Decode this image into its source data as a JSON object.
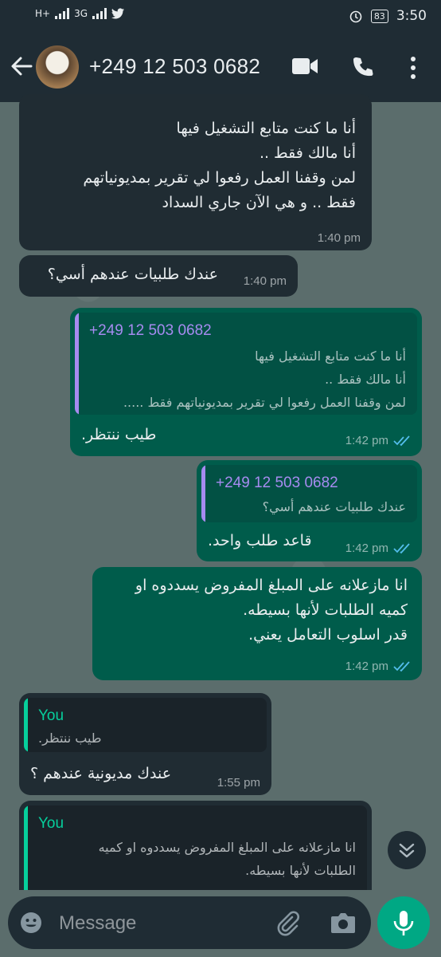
{
  "status_bar": {
    "network_1": "H+",
    "network_2": "3G",
    "battery": "83",
    "time": "3:50"
  },
  "header": {
    "contact": "+249 12 503 0682"
  },
  "messages": [
    {
      "direction": "in",
      "lines": [
        "أنا ما كنت متابع التشغيل فيها",
        "أنا مالك فقط ..",
        "لمن وقفنا العمل رفعوا لي تقرير بمديونياتهم",
        "فقط .. و هي الآن جاري السداد"
      ],
      "time": "1:40 pm"
    },
    {
      "direction": "in",
      "text": "عندك طلبيات عندهم أسي؟",
      "time": "1:40 pm"
    },
    {
      "direction": "out",
      "quote_name": "+249 12 503 0682",
      "quote_lines": [
        "أنا ما كنت متابع التشغيل فيها",
        "أنا مالك فقط ..",
        "لمن وقفنا العمل رفعوا لي تقرير بمديونياتهم فقط ....."
      ],
      "text": "طيب ننتظر.",
      "time": "1:42 pm"
    },
    {
      "direction": "out",
      "quote_name": "+249 12 503 0682",
      "quote_text": "عندك طلبيات عندهم أسي؟",
      "text": "قاعد طلب واحد.",
      "time": "1:42 pm"
    },
    {
      "direction": "out",
      "lines": [
        "انا مازعلانه على المبلغ المفروض يسددوه او",
        "كميه الطلبات لأنها بسيطه.",
        "قدر اسلوب التعامل يعني."
      ],
      "time": "1:42 pm"
    },
    {
      "direction": "in",
      "quote_name": "You",
      "quote_text": "طيب ننتظر.",
      "text": "عندك مديونية عندهم ؟",
      "time": "1:55 pm"
    },
    {
      "direction": "in",
      "quote_name": "You",
      "quote_lines": [
        "انا مازعلانه على المبلغ المفروض يسددوه او كميه",
        "الطلبات لأنها بسيطه."
      ]
    }
  ],
  "composer": {
    "placeholder": "Message"
  },
  "colors": {
    "incoming": "#202c33",
    "outgoing": "#005c4b",
    "accent_green": "#00a884",
    "quote_purple": "#a68bf0",
    "quote_green_name": "#06cf9c",
    "read_ticks": "#53bdeb"
  }
}
